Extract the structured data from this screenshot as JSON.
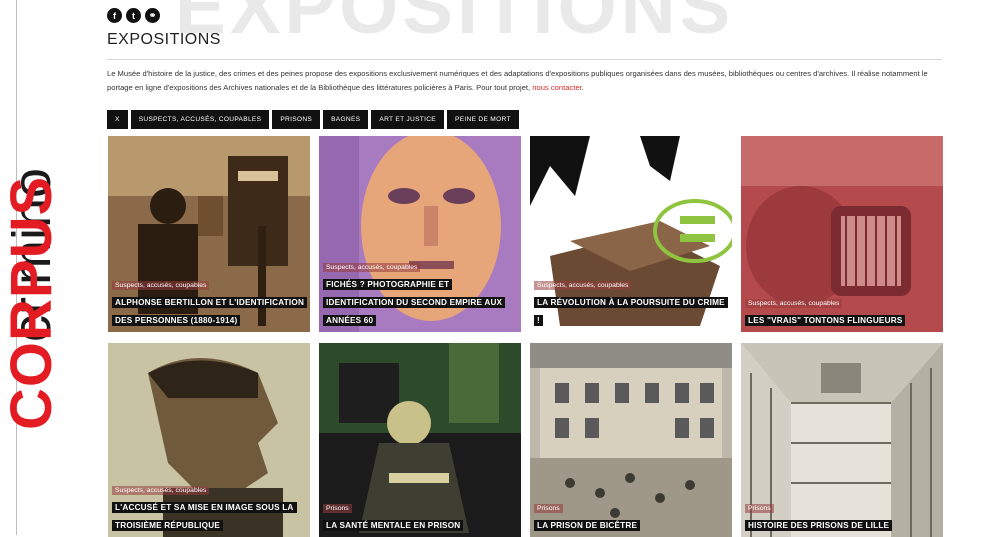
{
  "side_logo": {
    "brand_red": "CORPUS",
    "brand_dark": "criminо"
  },
  "social": [
    {
      "icon": "facebook-icon",
      "glyph": "f"
    },
    {
      "icon": "twitter-icon",
      "glyph": "t"
    },
    {
      "icon": "link-icon",
      "glyph": "⚭"
    }
  ],
  "watermark": "EXPOSITIONS",
  "page": {
    "title": "EXPOSITIONS",
    "intro": "Le Musée d'histoire de la justice, des crimes et des peines propose des expositions exclusivement numériques et des adaptations d'expositions publiques organisées dans des musées, bibliothèques ou centres d'archives. Il réalise notamment le portage en ligne d'expositions des Archives nationales et de la Bibliothèque des littératures policières à Paris. Pour tout projet, ",
    "contact_link": "nous contacter"
  },
  "filters": [
    "X",
    "SUSPECTS, ACCUSÉS, COUPABLES",
    "PRISONS",
    "BAGNES",
    "ART ET JUSTICE",
    "PEINE DE MORT"
  ],
  "cards": [
    {
      "category": "Suspects, accusés, coupables",
      "title": "ALPHONSE BERTILLON ET L'IDENTIFICATION DES PERSONNES (1880-1914)"
    },
    {
      "category": "Suspects, accusés, coupables",
      "title": "FICHÉS ? PHOTOGRAPHIE ET IDENTIFICATION DU SECOND EMPIRE AUX ANNÉES 60"
    },
    {
      "category": "Suspects, accusés, coupables",
      "title": "LA RÉVOLUTION À LA POURSUITE DU CRIME !"
    },
    {
      "category": "Suspects, accusés, coupables",
      "title": "LES \"VRAIS\" TONTONS FLINGUEURS"
    },
    {
      "category": "Suspects, accusés, coupables",
      "title": "L'ACCUSÉ ET SA MISE EN IMAGE SOUS LA TROISIÈME RÉPUBLIQUE"
    },
    {
      "category": "Prisons",
      "title": "LA SANTÉ MENTALE EN PRISON"
    },
    {
      "category": "Prisons",
      "title": "LA PRISON DE BICÊTRE"
    },
    {
      "category": "Prisons",
      "title": "HISTOIRE DES PRISONS DE LILLE"
    }
  ],
  "colors": {
    "accent_red": "#e31b23",
    "link_red": "#d42a2a",
    "button_black": "#111111"
  }
}
